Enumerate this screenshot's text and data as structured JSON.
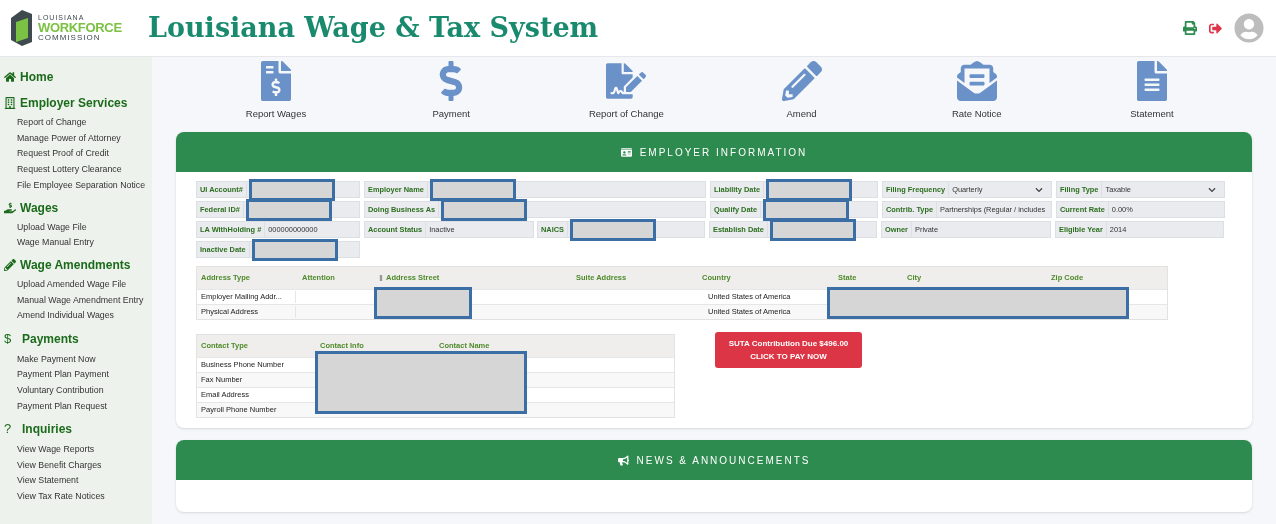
{
  "header": {
    "logo": {
      "line1": "LOUISIANA",
      "line2": "WORKFORCE",
      "line3": "COMMISSION"
    },
    "title": "Louisiana Wage & Tax System"
  },
  "sidebar": [
    {
      "label": "Home"
    },
    {
      "label": "Employer Services",
      "items": [
        "Report of Change",
        "Manage Power of Attorney",
        "Request Proof of Credit",
        "Request Lottery Clearance",
        "File Employee Separation Notice"
      ]
    },
    {
      "label": "Wages",
      "items": [
        "Upload Wage File",
        "Wage Manual Entry"
      ]
    },
    {
      "label": "Wage Amendments",
      "items": [
        "Upload Amended Wage File",
        "Manual Wage Amendment Entry",
        "Amend Individual Wages"
      ]
    },
    {
      "label": "Payments",
      "icon_text": "$",
      "items": [
        "Make Payment Now",
        "Payment Plan Payment",
        "Voluntary Contribution",
        "Payment Plan Request"
      ]
    },
    {
      "label": "Inquiries",
      "icon_text": "?",
      "items": [
        "View Wage Reports",
        "View Benefit Charges",
        "View Statement",
        "View Tax Rate Notices"
      ]
    }
  ],
  "quick_links": [
    {
      "label": "Report Wages"
    },
    {
      "label": "Payment"
    },
    {
      "label": "Report of Change"
    },
    {
      "label": "Amend"
    },
    {
      "label": "Rate Notice"
    },
    {
      "label": "Statement"
    }
  ],
  "employer_info": {
    "title": "EMPLOYER INFORMATION",
    "rows": [
      [
        {
          "label": "UI Account#",
          "redacted": true
        },
        {
          "label": "Employer Name",
          "redacted": true
        },
        {
          "label": "Liability Date",
          "redacted": true
        },
        {
          "label": "Filing Frequency",
          "value": "Quarterly",
          "kind": "select",
          "redacted": false
        },
        {
          "label": "Filing Type",
          "value": "Taxable",
          "kind": "select",
          "redacted": false
        }
      ],
      [
        {
          "label": "Federal ID#",
          "redacted": true
        },
        {
          "label": "Doing Business As",
          "redacted": true
        },
        {
          "label": "Qualify Date",
          "redacted": true
        },
        {
          "label": "Contrib. Type",
          "value": "Partnerships (Regular / includes",
          "redacted": false
        },
        {
          "label": "Current Rate",
          "value": "0.00%",
          "redacted": false
        }
      ],
      [
        {
          "label": "LA WithHolding #",
          "value": "000000000000",
          "redacted": false
        },
        {
          "parts": [
            {
              "label": "Account Status",
              "value": "Inactive",
              "redacted": false
            },
            {
              "label": "NAICS",
              "redacted": true
            }
          ]
        },
        {
          "label": "Establish Date",
          "redacted": true
        },
        {
          "label": "Owner",
          "value": "Private",
          "redacted": false
        },
        {
          "label": "Eligible Year",
          "value": "2014",
          "redacted": false
        }
      ],
      [
        {
          "label": "Inactive Date",
          "redacted": true
        }
      ]
    ],
    "address_table": {
      "columns": [
        "Address Type",
        "Attention",
        "Address Street",
        "Suite Address",
        "Country",
        "State",
        "City",
        "Zip Code"
      ],
      "rows": [
        [
          "Employer Mailing Addr...",
          "United States of America"
        ],
        [
          "Physical Address",
          "United States of America"
        ]
      ],
      "redacted": true
    },
    "contact_table": {
      "columns": [
        "Contact Type",
        "Contact Info",
        "Contact Name"
      ],
      "rows": [
        "Business Phone Number",
        "Fax Number",
        "Email Address",
        "Payroll Phone Number"
      ],
      "redacted": true
    },
    "due_button": {
      "line1": "SUTA Contribution Due $496.00",
      "line2": "CLICK TO PAY NOW"
    }
  },
  "news": {
    "title": "NEWS & ANNOUNCEMENTS"
  }
}
